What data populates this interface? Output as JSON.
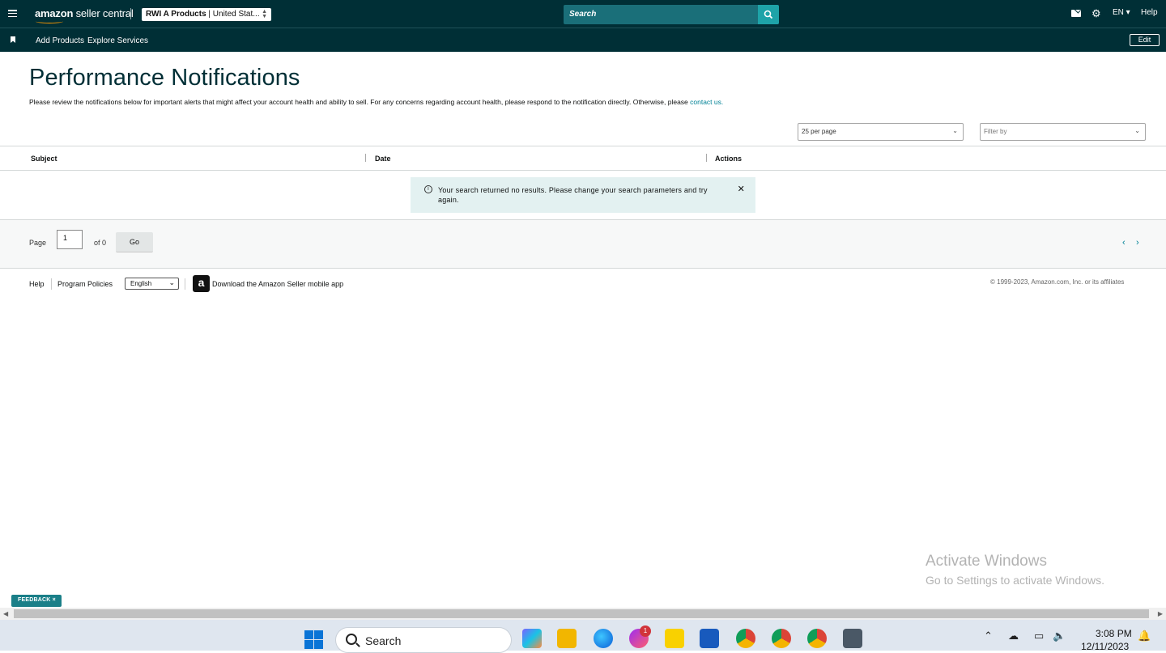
{
  "header": {
    "logo_main": "amazon",
    "logo_sub": "seller central",
    "account_bold": "RWI A Products",
    "account_rest": " | United Stat...",
    "search_placeholder": "Search",
    "language": "EN ▾",
    "help": "Help"
  },
  "nav": {
    "add_products": "Add Products",
    "explore_services": "Explore Services",
    "edit": "Edit"
  },
  "page": {
    "title": "Performance Notifications",
    "description": "Please review the notifications below for important alerts that might affect your account health and ability to sell. For any concerns regarding account health, please respond to the notification directly. Otherwise, please ",
    "contact_link": "contact us."
  },
  "filters": {
    "per_page": "25 per page",
    "filter_by": "Filter by"
  },
  "table": {
    "columns": [
      "Subject",
      "Date",
      "Actions"
    ],
    "empty_message": "Your search returned no results. Please change your search parameters and try again."
  },
  "pager": {
    "page_label": "Page",
    "page_value": "1",
    "of_label": "of 0",
    "go": "Go"
  },
  "footer": {
    "help": "Help",
    "program_policies": "Program Policies",
    "language": "English",
    "app_download": "Download the Amazon Seller mobile app",
    "copyright": "© 1999-2023, Amazon.com, Inc. or its affiliates"
  },
  "watermark": {
    "line1": "Activate Windows",
    "line2": "Go to Settings to activate Windows."
  },
  "feedback": "FEEDBACK ×",
  "taskbar": {
    "search_label": "Search",
    "messenger_badge": "1",
    "time": "3:08 PM",
    "date": "12/11/2023"
  },
  "colors": {
    "header_bg": "#002f36",
    "accent_teal": "#008296",
    "search_bg": "#1a6f79",
    "notice_bg": "#e3f1f1"
  }
}
